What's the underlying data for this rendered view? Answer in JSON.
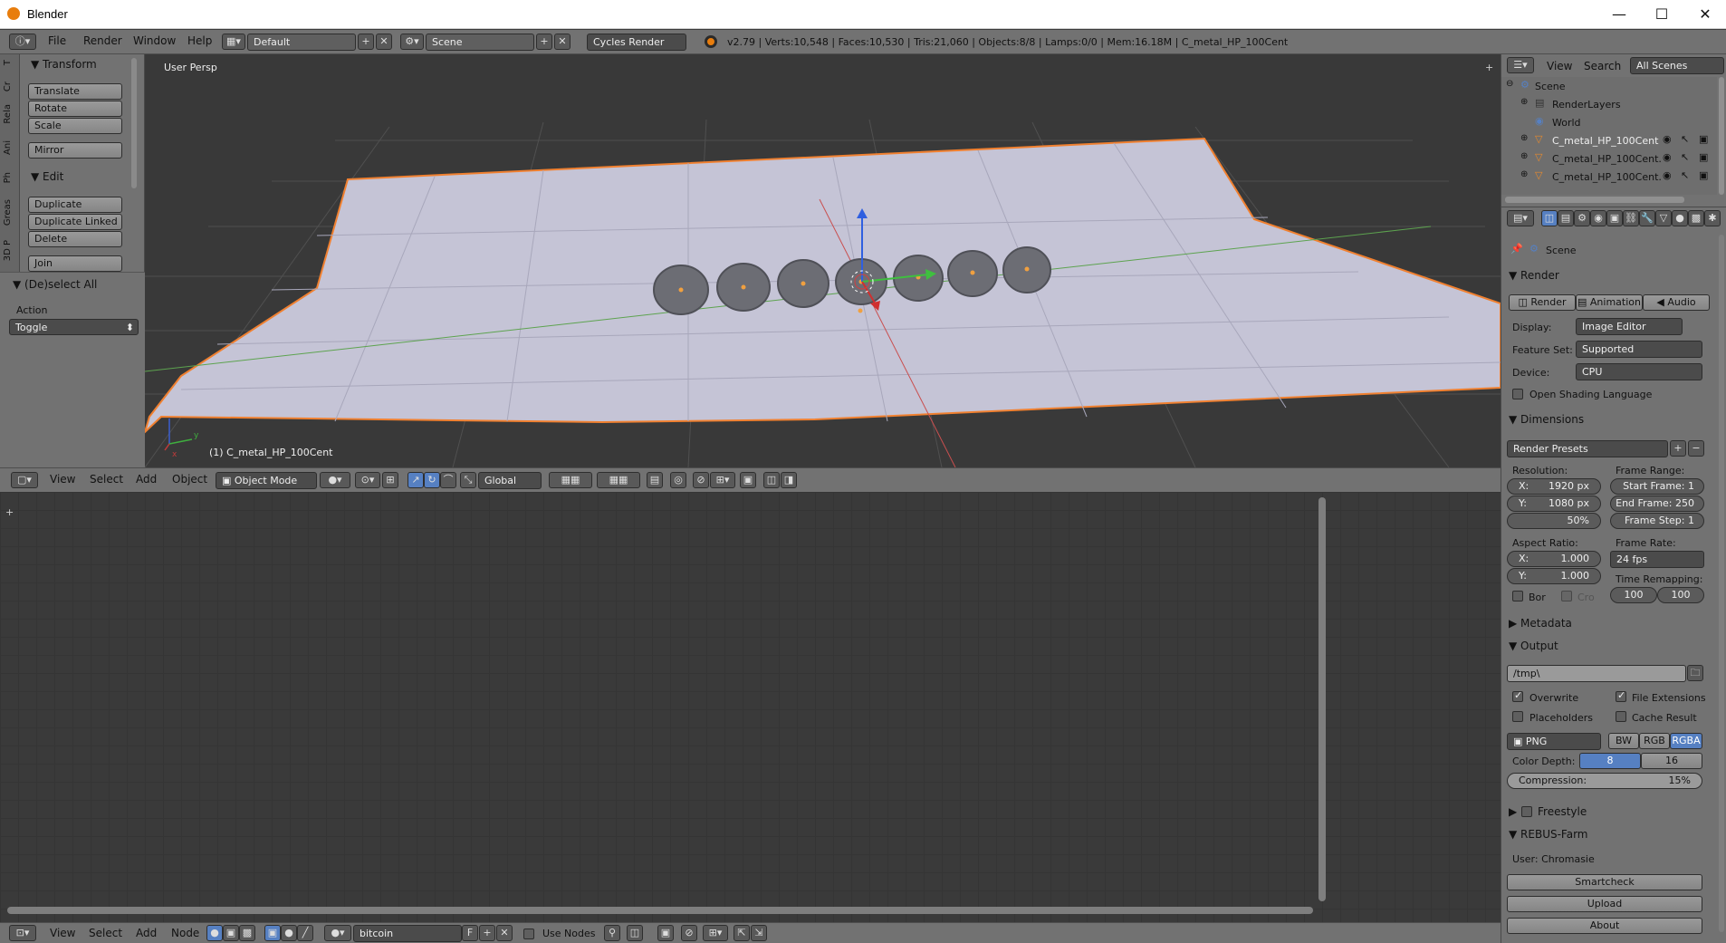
{
  "window": {
    "title": "Blender",
    "minimize": "—",
    "maximize": "☐",
    "close": "✕"
  },
  "menu": {
    "file": "File",
    "render": "Render",
    "window": "Window",
    "help": "Help"
  },
  "layout_dropdown": "Default",
  "scene_dropdown": "Scene",
  "engine_dropdown": "Cycles Render",
  "stats": "v2.79 | Verts:10,548 | Faces:10,530 | Tris:21,060 | Objects:8/8 | Lamps:0/0 | Mem:16.18M | C_metal_HP_100Cent",
  "toolshelf": {
    "tabs": [
      "T",
      "Cr",
      "Rela",
      "Ani",
      "Ph",
      "Greas",
      "3D P"
    ],
    "transform_header": "Transform",
    "translate": "Translate",
    "rotate": "Rotate",
    "scale": "Scale",
    "mirror": "Mirror",
    "edit_header": "Edit",
    "duplicate": "Duplicate",
    "duplicate_linked": "Duplicate Linked",
    "delete": "Delete",
    "join": "Join",
    "deselect_header": "(De)select All",
    "action_label": "Action",
    "action_value": "Toggle"
  },
  "viewport": {
    "view_label": "User Persp",
    "object_label": "(1) C_metal_HP_100Cent"
  },
  "view3d_header": {
    "view": "View",
    "select": "Select",
    "add": "Add",
    "object": "Object",
    "mode": "Object Mode",
    "orientation": "Global"
  },
  "node_header": {
    "view": "View",
    "select": "Select",
    "add": "Add",
    "node": "Node",
    "material": "bitcoin",
    "fake_user": "F",
    "use_nodes": "Use Nodes"
  },
  "outliner": {
    "view": "View",
    "search": "Search",
    "filter": "All Scenes",
    "items": [
      "Scene",
      "RenderLayers",
      "World",
      "C_metal_HP_100Cent",
      "C_metal_HP_100Cent.",
      "C_metal_HP_100Cent."
    ]
  },
  "properties": {
    "context": "Scene",
    "render_header": "Render",
    "render_btn": "Render",
    "animation_btn": "Animation",
    "audio_btn": "Audio",
    "display_label": "Display:",
    "display_value": "Image Editor",
    "feature_label": "Feature Set:",
    "feature_value": "Supported",
    "device_label": "Device:",
    "device_value": "CPU",
    "osl": "Open Shading Language",
    "dimensions_header": "Dimensions",
    "presets": "Render Presets",
    "resolution_label": "Resolution:",
    "res_x": "1920 px",
    "res_y": "1080 px",
    "res_pct": "50%",
    "frame_range_label": "Frame Range:",
    "start_frame": "Start Frame: 1",
    "end_frame": "End Frame: 250",
    "frame_step": "Frame Step: 1",
    "aspect_label": "Aspect Ratio:",
    "aspect_x": "1.000",
    "aspect_y": "1.000",
    "frame_rate_label": "Frame Rate:",
    "frame_rate": "24 fps",
    "time_remap_label": "Time Remapping:",
    "remap_old": "100",
    "remap_new": "100",
    "border": "Bor",
    "crop": "Cro",
    "metadata_header": "Metadata",
    "output_header": "Output",
    "output_path": "/tmp\\",
    "overwrite": "Overwrite",
    "file_ext": "File Extensions",
    "placeholders": "Placeholders",
    "cache_result": "Cache Result",
    "format": "PNG",
    "bw": "BW",
    "rgb": "RGB",
    "rgba": "RGBA",
    "color_depth_label": "Color Depth:",
    "depth_8": "8",
    "depth_16": "16",
    "compression_label": "Compression:",
    "compression": "15%",
    "freestyle_header": "Freestyle",
    "rebus_header": "REBUS-Farm",
    "user": "User: Chromasie",
    "smartcheck": "Smartcheck",
    "upload": "Upload",
    "about": "About"
  },
  "colors": {
    "accent": "#5680c2",
    "selection": "#f08030",
    "plane": "#c5c4d6",
    "grid_bg": "#3a3a3a"
  }
}
